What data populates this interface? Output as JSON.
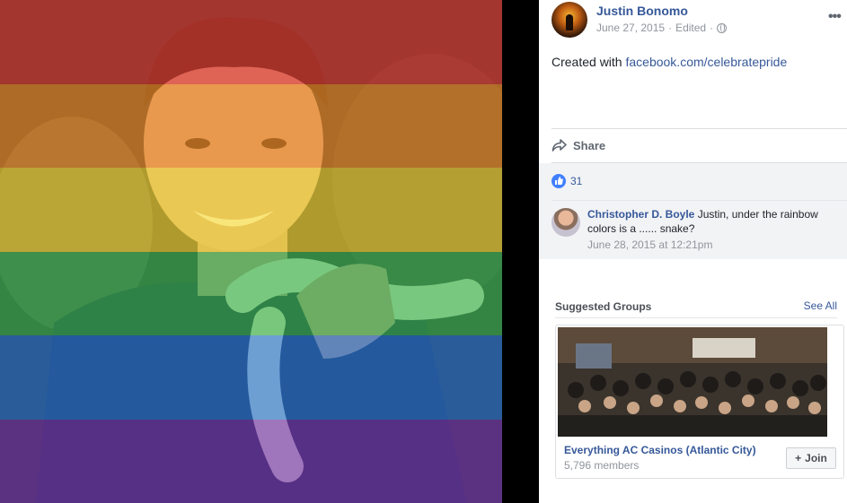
{
  "post": {
    "author": "Justin Bonomo",
    "date": "June 27, 2015",
    "edited": "Edited",
    "text_prefix": "Created with",
    "link": "facebook.com/celebratepride",
    "more_icon": "more-icon"
  },
  "actions": {
    "share_label": "Share"
  },
  "reactions": {
    "like_count": "31"
  },
  "comment": {
    "author": "Christopher D. Boyle",
    "text": "Justin, under the rainbow colors is a ...... snake?",
    "time": "June 28, 2015 at 12:21pm"
  },
  "suggested": {
    "title": "Suggested Groups",
    "see_all": "See All",
    "group_name": "Everything AC Casinos (Atlantic City)",
    "members": "5,796 members",
    "join_label": "Join"
  },
  "colors": {
    "link": "#365899",
    "rainbow": [
      "#e3362d",
      "#f28a1f",
      "#f5d72a",
      "#2fb34c",
      "#1f73d6",
      "#6d2fb0"
    ]
  }
}
